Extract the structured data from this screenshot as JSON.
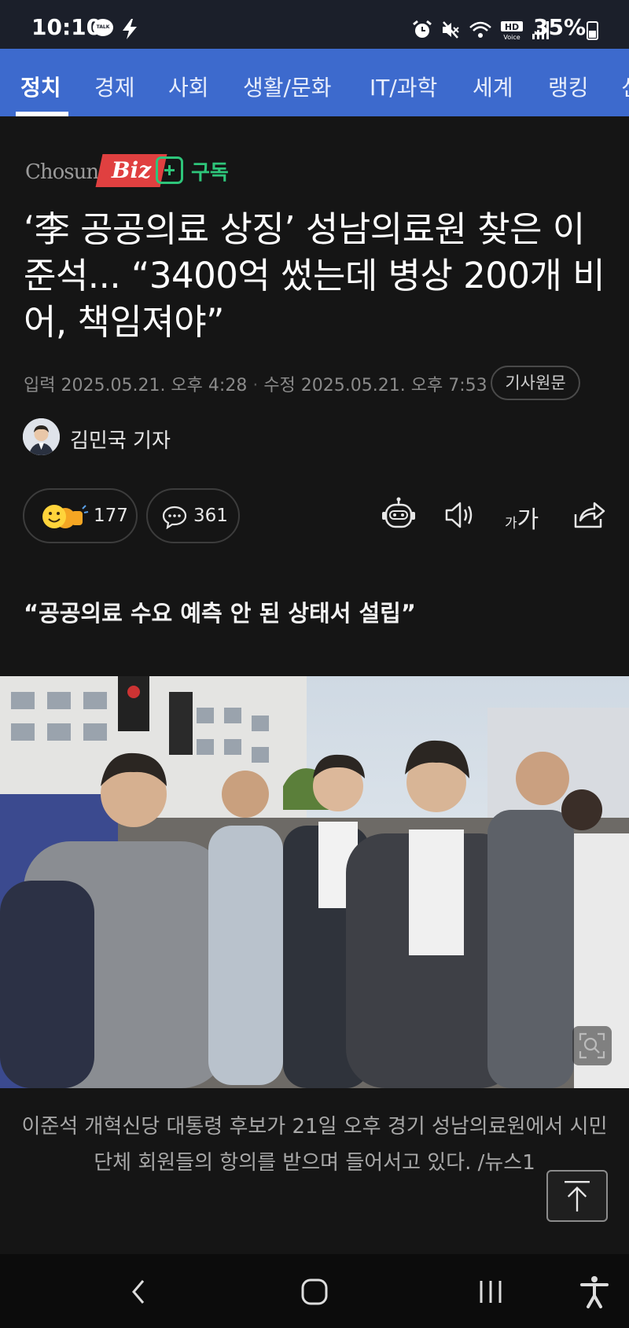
{
  "status_bar": {
    "time": "10:10",
    "talk_badge": "TALK",
    "battery_percent": "35%",
    "battery_level": 0.35,
    "icons": [
      "kakaotalk-icon",
      "lightning-icon",
      "alarm-icon",
      "mute-icon",
      "wifi-calling-icon",
      "hd-voice-icon",
      "signal-icon",
      "battery-icon"
    ]
  },
  "nav_tabs": [
    {
      "label": "정치",
      "active": true
    },
    {
      "label": "경제",
      "active": false
    },
    {
      "label": "사회",
      "active": false
    },
    {
      "label": "생활/문화",
      "active": false
    },
    {
      "label": "IT/과학",
      "active": false
    },
    {
      "label": "세계",
      "active": false
    },
    {
      "label": "랭킹",
      "active": false
    },
    {
      "label": "신",
      "active": false
    }
  ],
  "publisher": {
    "name_part1": "Chosun",
    "name_part2": "Biz",
    "subscribe_label": "구독"
  },
  "article": {
    "headline": "‘李 공공의료 상징’ 성남의료원 찾은 이준석... “3400억 썼는데 병상 200개 비어, 책임져야”",
    "input_label": "입력",
    "input_datetime": "2025.05.21. 오후 4:28",
    "edit_label": "수정",
    "edit_datetime": "2025.05.21. 오후 7:53",
    "original_button": "기사원문",
    "reporter": "김민국 기자",
    "reaction_count": "177",
    "comment_count": "361",
    "font_small": "가",
    "font_large": "가",
    "subheading": "“공공의료 수요 예측 안 된 상태서 설립”",
    "photo_caption": "이준석 개혁신당 대통령 후보가 21일 오후 경기 성남의료원에서 시민단체 회원들의 항의를 받으며 들어서고 있다. /뉴스1"
  },
  "colors": {
    "nav_blue": "#3d6acd",
    "background": "#151515",
    "subscribe_green": "#2ec57a",
    "brand_red": "#e04040"
  }
}
